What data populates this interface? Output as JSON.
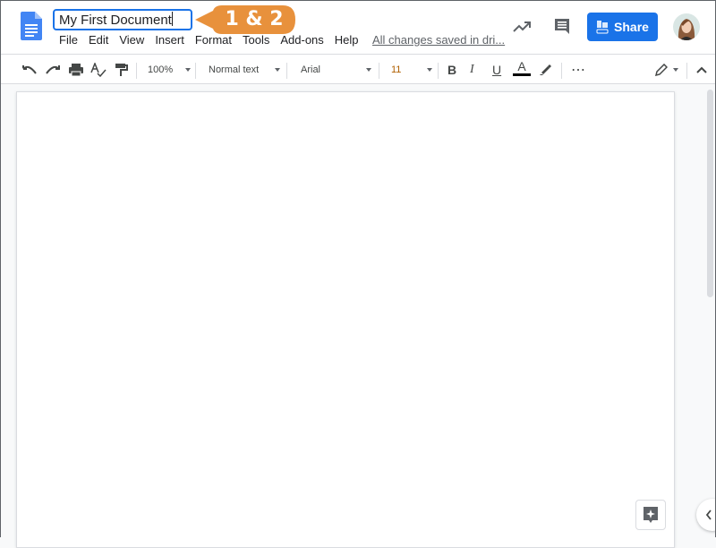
{
  "header": {
    "doc_title": "My First Document",
    "callout_label": "1 & 2",
    "menu": [
      "File",
      "Edit",
      "View",
      "Insert",
      "Format",
      "Tools",
      "Add-ons",
      "Help"
    ],
    "save_status": "All changes saved in dri...",
    "share_label": "Share"
  },
  "toolbar": {
    "zoom": "100%",
    "style": "Normal text",
    "font": "Arial",
    "font_size": "11"
  },
  "colors": {
    "accent": "#1a73e8",
    "callout": "#e8913c",
    "text_color_bar": "#000000"
  },
  "icons": [
    "docs-logo",
    "activity-icon",
    "comment-icon",
    "share-lock-icon",
    "avatar",
    "undo-icon",
    "redo-icon",
    "print-icon",
    "spellcheck-icon",
    "paint-format-icon",
    "bold-icon",
    "italic-icon",
    "underline-icon",
    "text-color-icon",
    "highlight-icon",
    "more-icon",
    "editing-mode-icon",
    "collapse-icon",
    "explore-icon",
    "side-panel-toggle-icon"
  ]
}
